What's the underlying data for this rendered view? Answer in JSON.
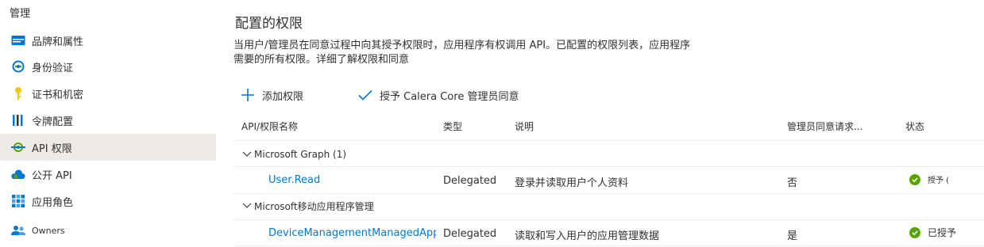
{
  "sidebar": {
    "header": "管理",
    "items": [
      {
        "label": "品牌和属性",
        "icon": "branding-icon"
      },
      {
        "label": "身份验证",
        "icon": "authentication-icon"
      },
      {
        "label": "证书和机密",
        "icon": "key-icon"
      },
      {
        "label": "令牌配置",
        "icon": "token-config-icon"
      },
      {
        "label": "API 权限",
        "icon": "api-permissions-icon",
        "active": true
      },
      {
        "label": "公开 API",
        "icon": "cloud-icon"
      },
      {
        "label": "应用角色",
        "icon": "app-roles-icon"
      },
      {
        "label": "Owners",
        "icon": "owners-icon"
      }
    ]
  },
  "main": {
    "title": "配置的权限",
    "description": "当用户/管理员在同意过程中向其授予权限时，应用程序有权调用 API。已配置的权限列表，应用程序需要的所有权限。详细了解权限和同意",
    "toolbar": {
      "add_label": "添加权限",
      "grant_label": "授予 Calera  Core 管理员同意"
    },
    "table": {
      "headers": {
        "name": "API/权限名称",
        "type": "类型",
        "description": "说明",
        "admin_consent": "管理员同意请求...",
        "status": "状态"
      },
      "groups": [
        {
          "label": "Microsoft Graph (1)",
          "rows": [
            {
              "name": "User.Read",
              "type": "Delegated",
              "description": "登录并读取用户个人资料",
              "admin_consent": "否",
              "status": "授予 ("
            }
          ]
        },
        {
          "label": "Microsoft移动应用程序管理",
          "rows": [
            {
              "name": "DeviceManagementManagedApps.Re",
              "type": "Delegated",
              "description": "读取和写入用户的应用管理数据",
              "admin_consent": "是",
              "status": "已授予"
            }
          ]
        }
      ]
    },
    "colors": {
      "accent": "#0078d4",
      "success": "#57a300",
      "selected_bg": "#edebe9"
    }
  }
}
